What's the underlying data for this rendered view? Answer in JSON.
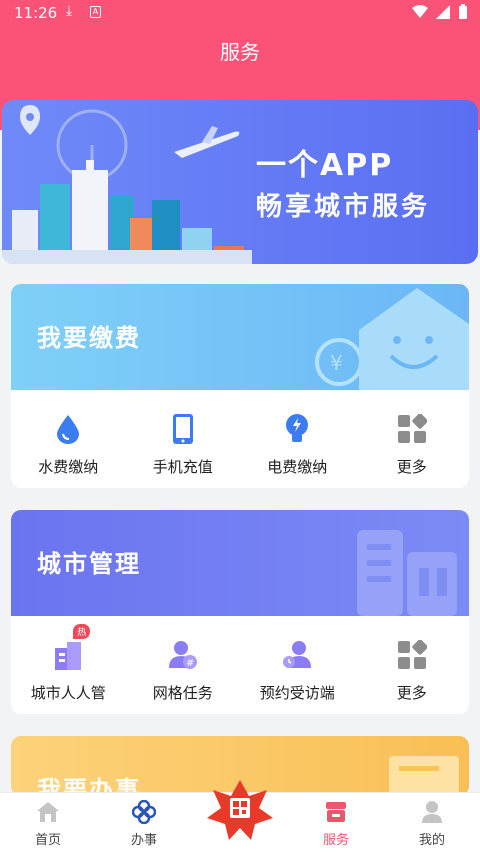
{
  "status": {
    "time": "11:26",
    "download_icon": "download-icon",
    "a_icon": "A"
  },
  "header": {
    "title": "服务"
  },
  "banner": {
    "line1": "一个APP",
    "line2": "畅享城市服务"
  },
  "cards": [
    {
      "title": "我要缴费",
      "items": [
        {
          "label": "水费缴纳",
          "icon": "water-drop-icon"
        },
        {
          "label": "手机充值",
          "icon": "phone-icon"
        },
        {
          "label": "电费缴纳",
          "icon": "bulb-icon"
        },
        {
          "label": "更多",
          "icon": "grid-icon"
        }
      ]
    },
    {
      "title": "城市管理",
      "items": [
        {
          "label": "城市人人管",
          "icon": "building-icon",
          "badge": "热"
        },
        {
          "label": "网格任务",
          "icon": "grid-task-icon"
        },
        {
          "label": "预约受访端",
          "icon": "visitor-icon"
        },
        {
          "label": "更多",
          "icon": "grid-icon"
        }
      ]
    },
    {
      "title": "我要办事"
    }
  ],
  "nav": [
    {
      "label": "首页",
      "icon": "home-icon"
    },
    {
      "label": "办事",
      "icon": "clover-icon"
    },
    {
      "label": "",
      "icon": "scan-qr-icon"
    },
    {
      "label": "服务",
      "icon": "shop-icon",
      "active": true
    },
    {
      "label": "我的",
      "icon": "user-icon"
    }
  ],
  "colors": {
    "header": "#fb5277",
    "active": "#f2546d",
    "card1": "#7ec8f6",
    "card2": "#6f79f0",
    "card3": "#fbc760"
  }
}
